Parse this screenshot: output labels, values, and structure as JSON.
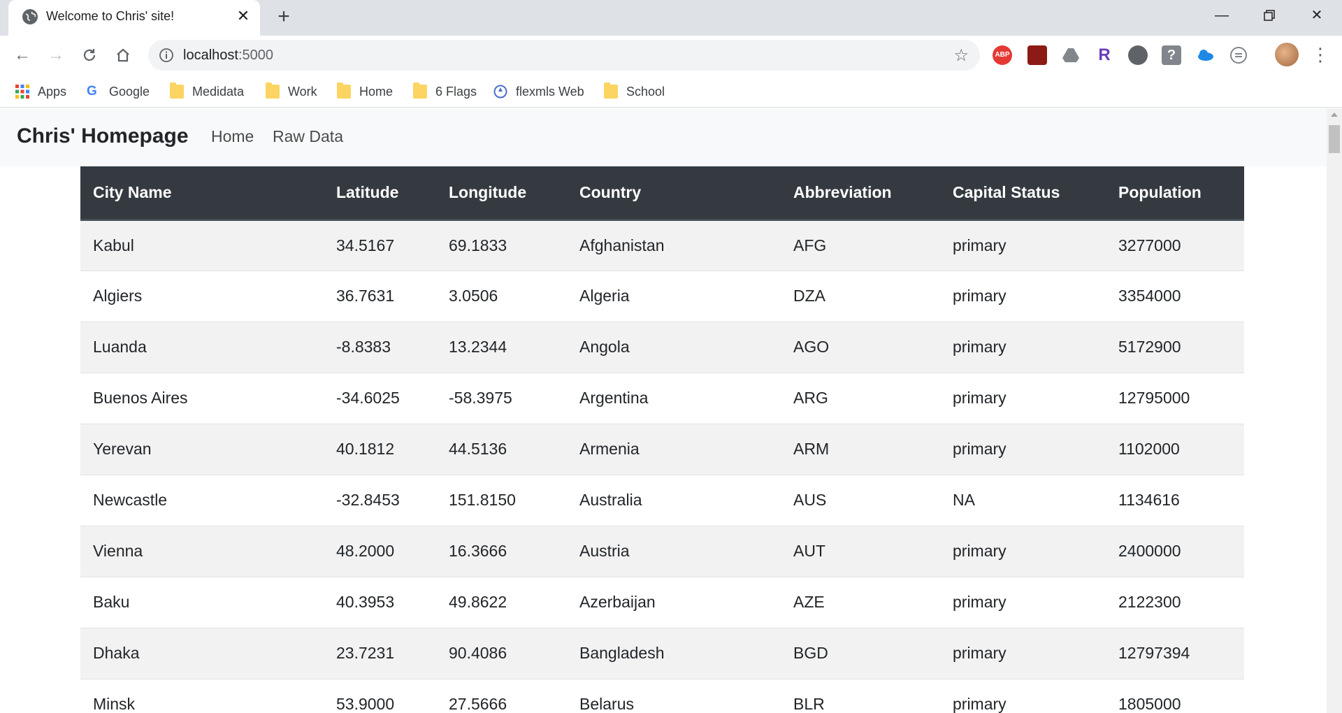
{
  "browser": {
    "tab_title": "Welcome to Chris' site!",
    "url_host": "localhost",
    "url_port": ":5000",
    "bookmarks": [
      {
        "label": "Apps",
        "icon": "apps-grid-icon"
      },
      {
        "label": "Google",
        "icon": "google-icon"
      },
      {
        "label": "Medidata",
        "icon": "folder-icon"
      },
      {
        "label": "Work",
        "icon": "folder-icon"
      },
      {
        "label": "Home",
        "icon": "folder-icon"
      },
      {
        "label": "6 Flags",
        "icon": "folder-icon"
      },
      {
        "label": "flexmls Web",
        "icon": "flexmls-icon"
      },
      {
        "label": "School",
        "icon": "folder-icon"
      }
    ],
    "extensions": [
      "adblock-plus-icon",
      "acrobat-icon",
      "drive-icon",
      "r-extension-icon",
      "circle-extension-icon",
      "help-extension-icon",
      "onedrive-icon",
      "cast-icon"
    ]
  },
  "navbar": {
    "brand": "Chris' Homepage",
    "links": [
      "Home",
      "Raw Data"
    ]
  },
  "table": {
    "headers": [
      "City Name",
      "Latitude",
      "Longitude",
      "Country",
      "Abbreviation",
      "Capital Status",
      "Population"
    ],
    "rows": [
      [
        "Kabul",
        "34.5167",
        "69.1833",
        "Afghanistan",
        "AFG",
        "primary",
        "3277000"
      ],
      [
        "Algiers",
        "36.7631",
        "3.0506",
        "Algeria",
        "DZA",
        "primary",
        "3354000"
      ],
      [
        "Luanda",
        "-8.8383",
        "13.2344",
        "Angola",
        "AGO",
        "primary",
        "5172900"
      ],
      [
        "Buenos Aires",
        "-34.6025",
        "-58.3975",
        "Argentina",
        "ARG",
        "primary",
        "12795000"
      ],
      [
        "Yerevan",
        "40.1812",
        "44.5136",
        "Armenia",
        "ARM",
        "primary",
        "1102000"
      ],
      [
        "Newcastle",
        "-32.8453",
        "151.8150",
        "Australia",
        "AUS",
        "NA",
        "1134616"
      ],
      [
        "Vienna",
        "48.2000",
        "16.3666",
        "Austria",
        "AUT",
        "primary",
        "2400000"
      ],
      [
        "Baku",
        "40.3953",
        "49.8622",
        "Azerbaijan",
        "AZE",
        "primary",
        "2122300"
      ],
      [
        "Dhaka",
        "23.7231",
        "90.4086",
        "Bangladesh",
        "BGD",
        "primary",
        "12797394"
      ],
      [
        "Minsk",
        "53.9000",
        "27.5666",
        "Belarus",
        "BLR",
        "primary",
        "1805000"
      ]
    ]
  }
}
